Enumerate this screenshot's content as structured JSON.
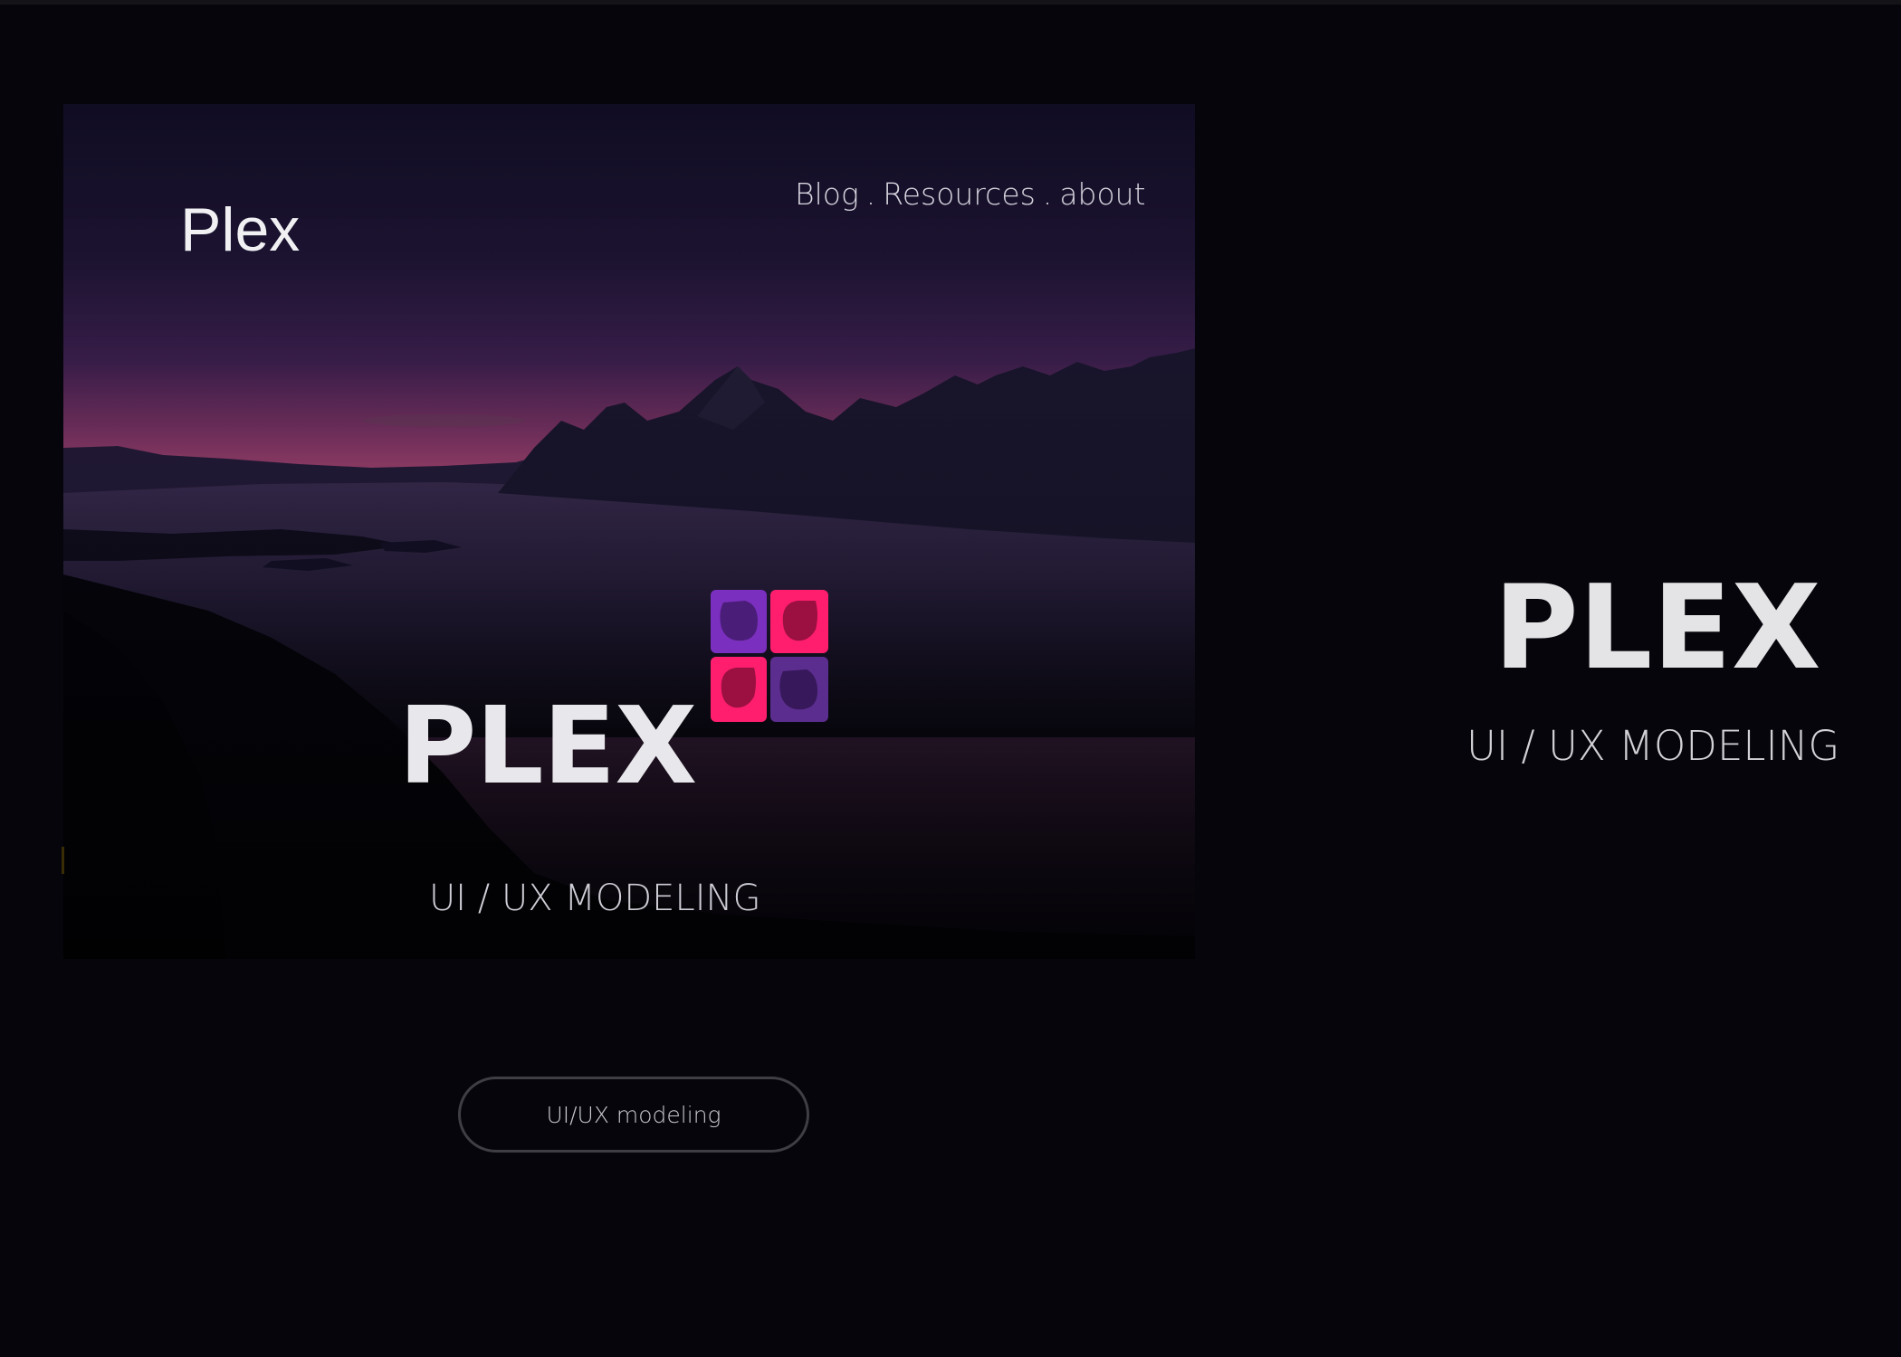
{
  "brand": "Plex",
  "nav": {
    "items": [
      {
        "label": "Blog"
      },
      {
        "label": "Resources"
      },
      {
        "label": "about"
      }
    ],
    "separator": "."
  },
  "hero": {
    "title": "PLEX",
    "subtitle": "UI / UX MODELING"
  },
  "button": {
    "label": "UI/UX modeling"
  },
  "side": {
    "title": "PLEX",
    "subtitle": "UI / UX MODELING"
  },
  "colors": {
    "background": "#05050b",
    "logo_purple": "#7b2fbf",
    "logo_pink": "#ff1e6e",
    "text": "#e8e7eb",
    "sky_glow": "#b0407a"
  },
  "icons": {
    "logo": "four-tile-logo-icon"
  }
}
